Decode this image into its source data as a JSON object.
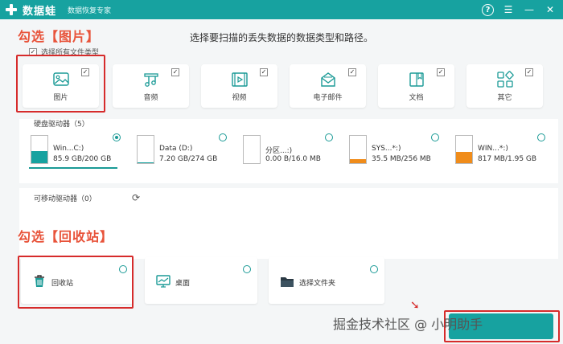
{
  "header": {
    "app_name": "数据蛙",
    "subtitle": "数据恢复专家",
    "icons": [
      "help-icon",
      "menu-icon",
      "minimize-icon",
      "close-icon"
    ]
  },
  "colors": {
    "brand": "#17a2a0",
    "annotation": "#e8533a",
    "highlight_border": "#d62b2b"
  },
  "prompt": "选择要扫描的丢失数据的数据类型和路径。",
  "annotations": {
    "select_pictures": "勾选【图片】",
    "select_recycle": "勾选【回收站】"
  },
  "select_all": {
    "label": "选择所有文件类型",
    "checked": true
  },
  "file_types": [
    {
      "label": "图片",
      "icon": "image-icon",
      "checked": true
    },
    {
      "label": "音频",
      "icon": "music-icon",
      "checked": true
    },
    {
      "label": "视频",
      "icon": "video-icon",
      "checked": true
    },
    {
      "label": "电子邮件",
      "icon": "mail-icon",
      "checked": true
    },
    {
      "label": "文档",
      "icon": "document-icon",
      "checked": true
    },
    {
      "label": "其它",
      "icon": "other-icon",
      "checked": true
    }
  ],
  "hard_drives": {
    "title": "硬盘驱动器（5）",
    "drives": [
      {
        "name": "Win...C:)",
        "size": "85.9 GB/200 GB",
        "selected": true,
        "fill_fraction": 0.43,
        "fill_color": "#17a2a0"
      },
      {
        "name": "Data (D:)",
        "size": "7.20 GB/274 GB",
        "selected": false,
        "fill_fraction": 0.03,
        "fill_color": "#17a2a0"
      },
      {
        "name": "分区...:)",
        "size": "0.00  B/16.0 MB",
        "selected": false,
        "fill_fraction": 0.0,
        "fill_color": "#f08c1a"
      },
      {
        "name": "SYS...*:)",
        "size": "35.5 MB/256 MB",
        "selected": false,
        "fill_fraction": 0.14,
        "fill_color": "#f08c1a"
      },
      {
        "name": "WIN...*:)",
        "size": "817 MB/1.95 GB",
        "selected": false,
        "fill_fraction": 0.42,
        "fill_color": "#f08c1a"
      }
    ]
  },
  "removable": {
    "title": "可移动驱动器（0）"
  },
  "locations": [
    {
      "label": "回收站",
      "icon": "recycle-bin-icon",
      "selected": false
    },
    {
      "label": "桌面",
      "icon": "desktop-icon",
      "selected": false
    },
    {
      "label": "选择文件夹",
      "icon": "folder-icon",
      "selected": false
    }
  ],
  "watermark": "掘金技术社区 @ 小明助手"
}
